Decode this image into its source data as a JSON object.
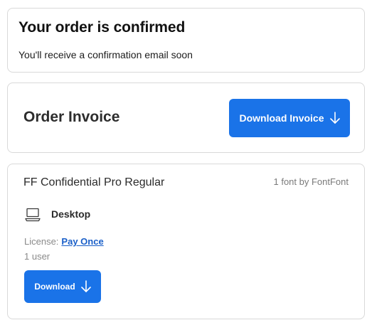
{
  "confirmation": {
    "title": "Your order is confirmed",
    "subtitle": "You'll receive a confirmation email soon"
  },
  "invoice": {
    "title": "Order Invoice",
    "download_label": "Download Invoice",
    "download_icon": "arrow-down-icon"
  },
  "order_item": {
    "font_name": "FF Confidential Pro Regular",
    "meta": "1 font by FontFont",
    "platform_icon": "desktop-monitor-icon",
    "platform": "Desktop",
    "license_label": "License:",
    "license_value": "Pay Once",
    "users": "1 user",
    "download_label": "Download",
    "download_icon": "arrow-down-icon"
  },
  "colors": {
    "accent": "#1a73e8",
    "link": "#1a5fc8",
    "border": "#d9d9d9",
    "muted_text": "#8a8a8a"
  }
}
